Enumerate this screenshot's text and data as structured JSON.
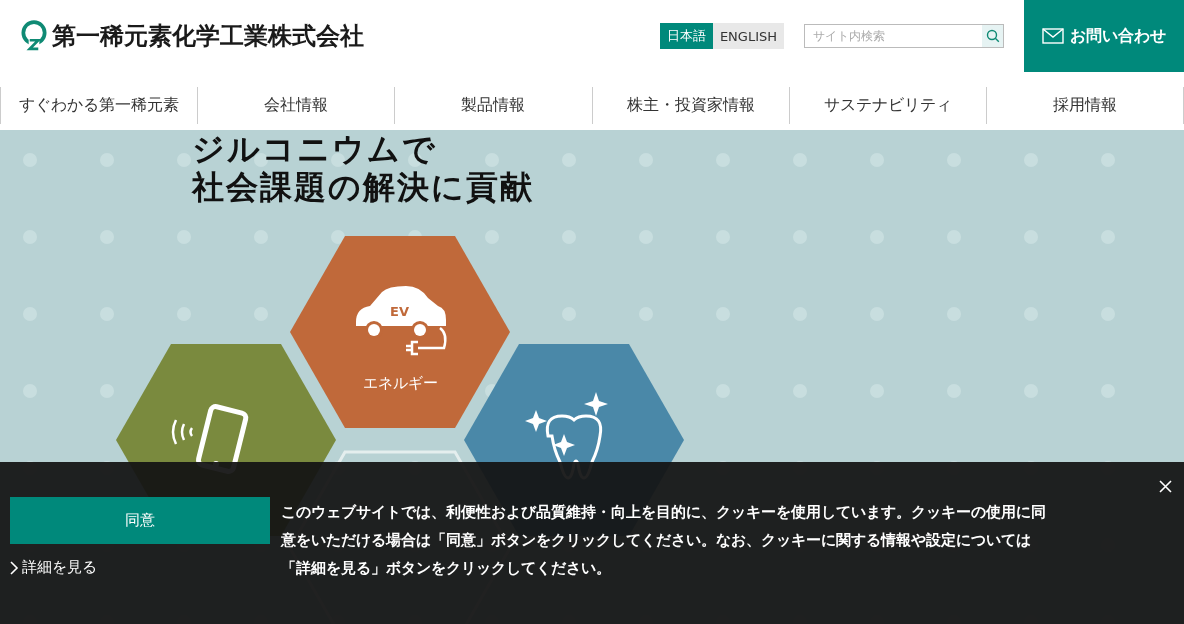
{
  "header": {
    "company_name": "第一稀元素化学工業株式会社",
    "languages": [
      {
        "label": "日本語",
        "selected": true
      },
      {
        "label": "ENGLISH",
        "selected": false
      }
    ],
    "search": {
      "placeholder": "サイト内検索"
    },
    "contact_button": "お問い合わせ"
  },
  "nav": {
    "items": [
      {
        "label": "すぐわかる第一稀元素"
      },
      {
        "label": "会社情報"
      },
      {
        "label": "製品情報"
      },
      {
        "label": "株主・投資家情報"
      },
      {
        "label": "サステナビリティ"
      },
      {
        "label": "採用情報"
      }
    ]
  },
  "hero": {
    "headline": [
      "ジルコニウムで",
      "社会課題の解決に貢献"
    ],
    "hexagons": [
      {
        "kind": "energy",
        "label": "エネルギー",
        "icon_text": "EV",
        "color": "#c0693a"
      },
      {
        "kind": "electronics",
        "color": "#7a8a3e"
      },
      {
        "kind": "healthcare",
        "color": "#4a88a8"
      },
      {
        "kind": "outline"
      }
    ]
  },
  "cookie_banner": {
    "agree_button": "同意",
    "details_link": "詳細を見る",
    "message": "このウェブサイトでは、利便性および品質維持・向上を目的に、クッキーを使用しています。クッキーの使用に同意をいただける場合は「同意」ボタンをクリックしてください。なお、クッキーに関する情報や設定については「詳細を見る」ボタンをクリックしてください。"
  }
}
